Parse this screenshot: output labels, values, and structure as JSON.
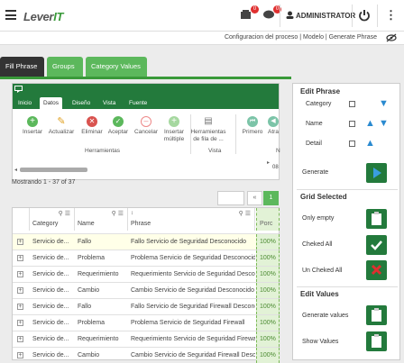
{
  "header": {
    "logo_main": "Lever",
    "logo_accent": "IT",
    "user": "ADMINISTRATOR",
    "badge1": "0",
    "badge2": "0"
  },
  "breadcrumb": "Configuracion del proceso | Modelo | Generate Phrase",
  "tabs": [
    {
      "label": "Fill Phrase"
    },
    {
      "label": "Groups"
    },
    {
      "label": "Category Values"
    }
  ],
  "ribbon": {
    "tabs": [
      "Inicio",
      "Datos",
      "Diseño",
      "Vista",
      "Fuente"
    ],
    "buttons": [
      "Insertar",
      "Actualizar",
      "Eliminar",
      "Aceptar",
      "Cancelar",
      "Insertar múltiple",
      "Herramientas de fila de ...",
      "Primero",
      "Atra"
    ],
    "groups": [
      "Herramientas",
      "Vista",
      "N"
    ],
    "scroll_value": "08"
  },
  "showing": "Mostrando 1 - 37 of 37",
  "pager": {
    "page": "1"
  },
  "grid": {
    "columns": [
      "Category",
      "Name",
      "Phrase",
      "Porc"
    ],
    "rows": [
      {
        "category": "Servicio de...",
        "name": "Fallo",
        "phrase": "Fallo Servicio de Seguridad Desconocido",
        "porc": "100%"
      },
      {
        "category": "Servicio de...",
        "name": "Problema",
        "phrase": "Problema Servicio de Seguridad Desconocido",
        "porc": "100%"
      },
      {
        "category": "Servicio de...",
        "name": "Requerimiento",
        "phrase": "Requerimiento Servicio de Seguridad Desconocido",
        "porc": "100%"
      },
      {
        "category": "Servicio de...",
        "name": "Cambio",
        "phrase": "Cambio Servicio de Seguridad Desconocido",
        "porc": "100%"
      },
      {
        "category": "Servicio de...",
        "name": "Fallo",
        "phrase": "Fallo Servicio de Seguridad Firewall Desconocido",
        "porc": "100%"
      },
      {
        "category": "Servicio de...",
        "name": "Problema",
        "phrase": "Problema Servicio de Seguridad Firewall",
        "porc": "100%"
      },
      {
        "category": "Servicio de...",
        "name": "Requerimiento",
        "phrase": "Requerimiento Servicio de Seguridad Firewall",
        "porc": "100%"
      },
      {
        "category": "Servicio de...",
        "name": "Cambio",
        "phrase": "Cambio Servicio de Seguridad Firewall Desconocido",
        "porc": "100%"
      }
    ]
  },
  "panel": {
    "edit_phrase": "Edit Phrase",
    "category": "Category",
    "name": "Name",
    "detail": "Detail",
    "generate": "Generate",
    "grid_selected": "Grid Selected",
    "only_empty": "Only empty",
    "checked_all": "Cheked All",
    "unchecked_all": "Un Cheked All",
    "edit_values": "Edit Values",
    "generate_values": "Generate values",
    "show_values": "Show Values"
  }
}
